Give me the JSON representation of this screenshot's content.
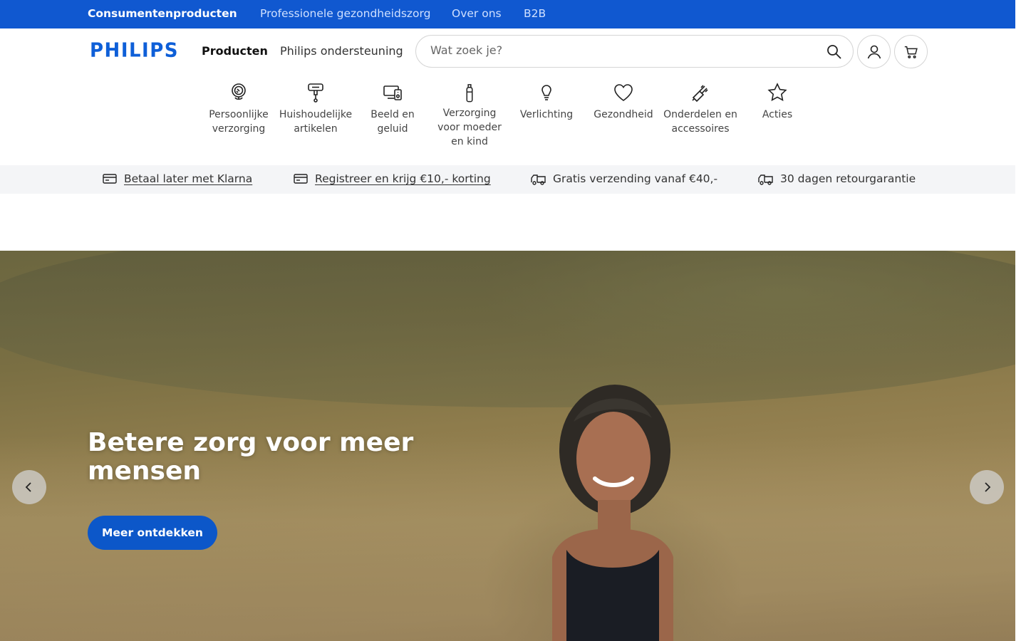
{
  "topbar": {
    "links": [
      "Consumentenproducten",
      "Professionele gezondheidszorg",
      "Over ons",
      "B2B"
    ]
  },
  "header": {
    "logo": "PHILIPS",
    "nav": [
      "Producten",
      "Philips ondersteuning"
    ],
    "search_placeholder": "Wat zoek je?"
  },
  "categories": [
    {
      "label": "Persoonlijke verzorging",
      "icon": "mirror-icon"
    },
    {
      "label": "Huishoudelijke artikelen",
      "icon": "mixer-icon"
    },
    {
      "label": "Beeld en geluid",
      "icon": "devices-icon"
    },
    {
      "label": "Verzorging voor moeder en kind",
      "icon": "baby-bottle-icon"
    },
    {
      "label": "Verlichting",
      "icon": "lightbulb-icon"
    },
    {
      "label": "Gezondheid",
      "icon": "heart-icon"
    },
    {
      "label": "Onderdelen en accessoires",
      "icon": "brush-head-icon"
    },
    {
      "label": "Acties",
      "icon": "star-icon"
    }
  ],
  "usp": [
    {
      "text": "Betaal later met Klarna",
      "icon": "card-icon"
    },
    {
      "text": "Registreer en krijg €10,- korting",
      "icon": "card-icon"
    },
    {
      "text": "Gratis verzending vanaf €40,-",
      "icon": "truck-icon"
    },
    {
      "text": "30 dagen retourgarantie",
      "icon": "truck-icon"
    }
  ],
  "hero": {
    "title": "Betere zorg voor meer mensen",
    "cta": "Meer ontdekken"
  },
  "colors": {
    "brand_blue": "#0e5fd8",
    "topbar": "#1058d0",
    "cta": "#0c57c9"
  }
}
